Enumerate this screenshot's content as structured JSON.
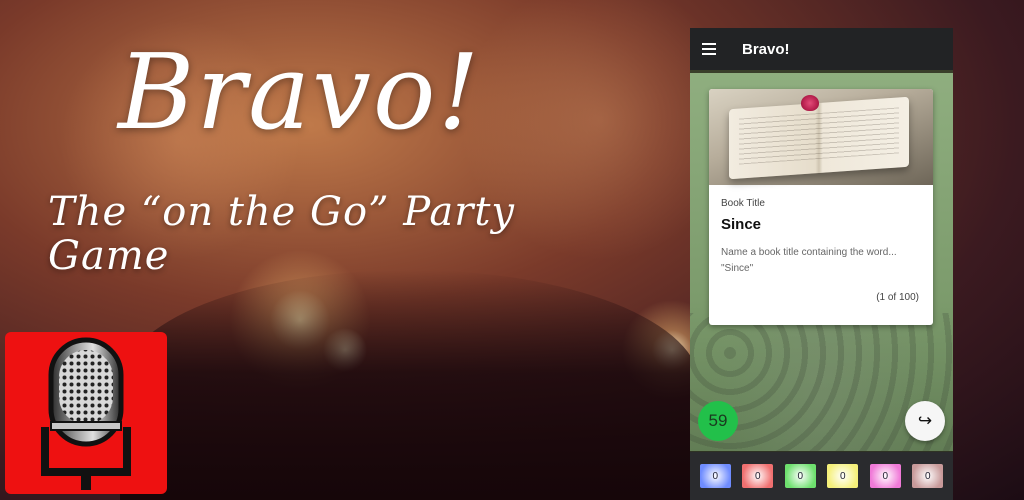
{
  "promo": {
    "title": "Bravo!",
    "tagline": "The “on the Go” Party Game"
  },
  "app_icon": {
    "icon": "microphone-icon",
    "color": "#ee1111"
  },
  "app": {
    "title": "Bravo!",
    "menu_icon": "hamburger-menu-icon",
    "card": {
      "category": "Book Title",
      "word": "Since",
      "prompt_line1": "Name a book title containing the word...",
      "prompt_line2": "\"Since\"",
      "count": "(1 of 100)"
    },
    "timer": "59",
    "next_icon": "↪",
    "teams": [
      {
        "score": "0",
        "color": "#6f8cff"
      },
      {
        "score": "0",
        "color": "#f07070"
      },
      {
        "score": "0",
        "color": "#6ee06e"
      },
      {
        "score": "0",
        "color": "#f5f07a"
      },
      {
        "score": "0",
        "color": "#f07ad8"
      },
      {
        "score": "0",
        "color": "#c89a9a"
      }
    ]
  }
}
